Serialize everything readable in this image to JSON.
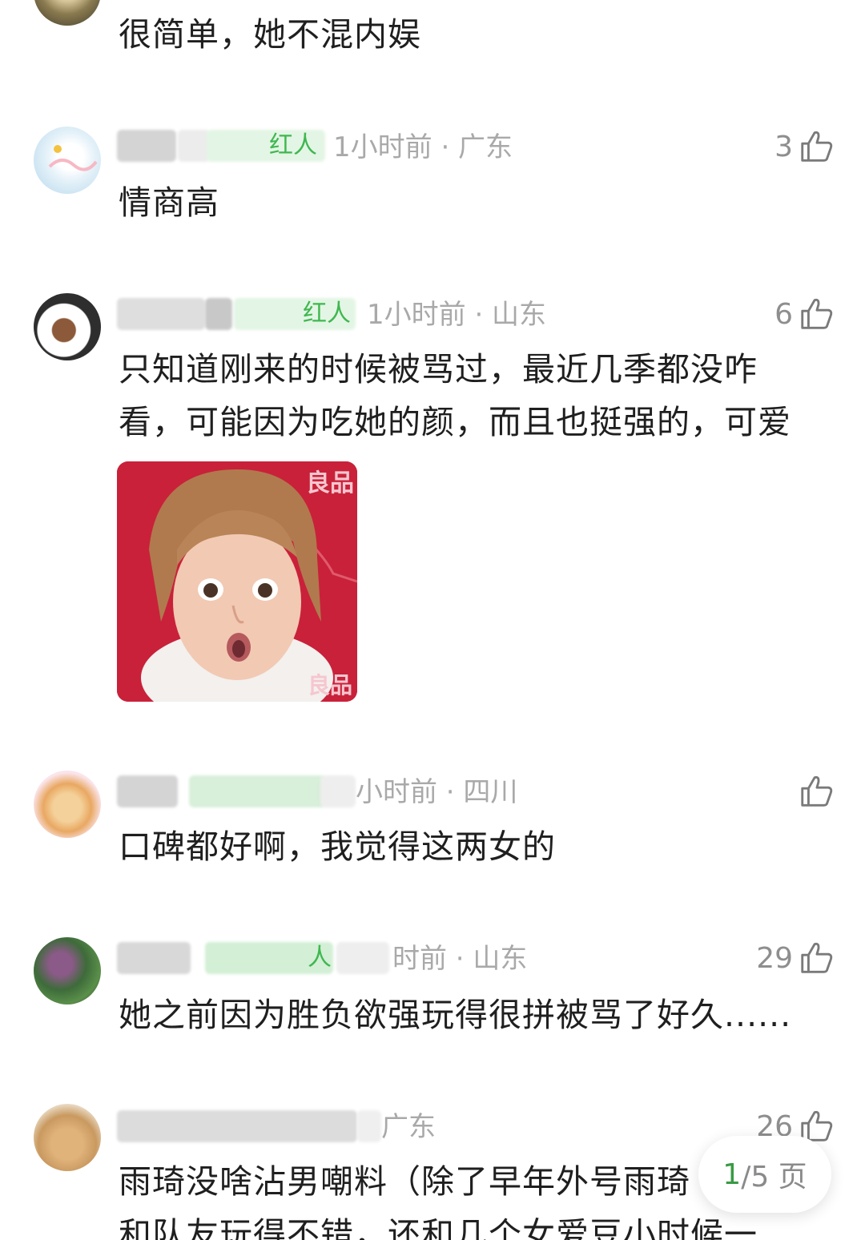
{
  "colors": {
    "accent_green": "#3fb750",
    "meta_gray": "#a9a9a9",
    "text": "#1f1f1f",
    "image_bg": "#c9213a"
  },
  "comments": [
    {
      "text": "很简单，她不混内娱"
    },
    {
      "badge": "红人",
      "meta": "1小时前 · 广东",
      "likes": "3",
      "text": "情商高"
    },
    {
      "badge": "红人",
      "meta": "1小时前 · 山东",
      "likes": "6",
      "text": "只知道刚来的时候被骂过，最近几季都没咋看，可能因为吃她的颜，而且也挺强的，可爱",
      "image_sign_top": "良品",
      "image_sign_bottom": "良品"
    },
    {
      "meta": "小时前 · 四川",
      "likes": "",
      "text": "口碑都好啊，我觉得这两女的"
    },
    {
      "badge": "人",
      "meta": "时前 · 山东",
      "likes": "29",
      "text": "她之前因为胜负欲强玩得很拼被骂了好久......"
    },
    {
      "meta": "广东",
      "likes": "26",
      "text": "雨琦没啥沾男嘲料（除了早年外号雨琦",
      "text2": "和队友玩得不错，还和几个女爱豆小时候一"
    }
  ],
  "pager": {
    "current": "1",
    "total_text": "/5 页"
  },
  "icons": {
    "like": "thumbs-up-icon"
  }
}
